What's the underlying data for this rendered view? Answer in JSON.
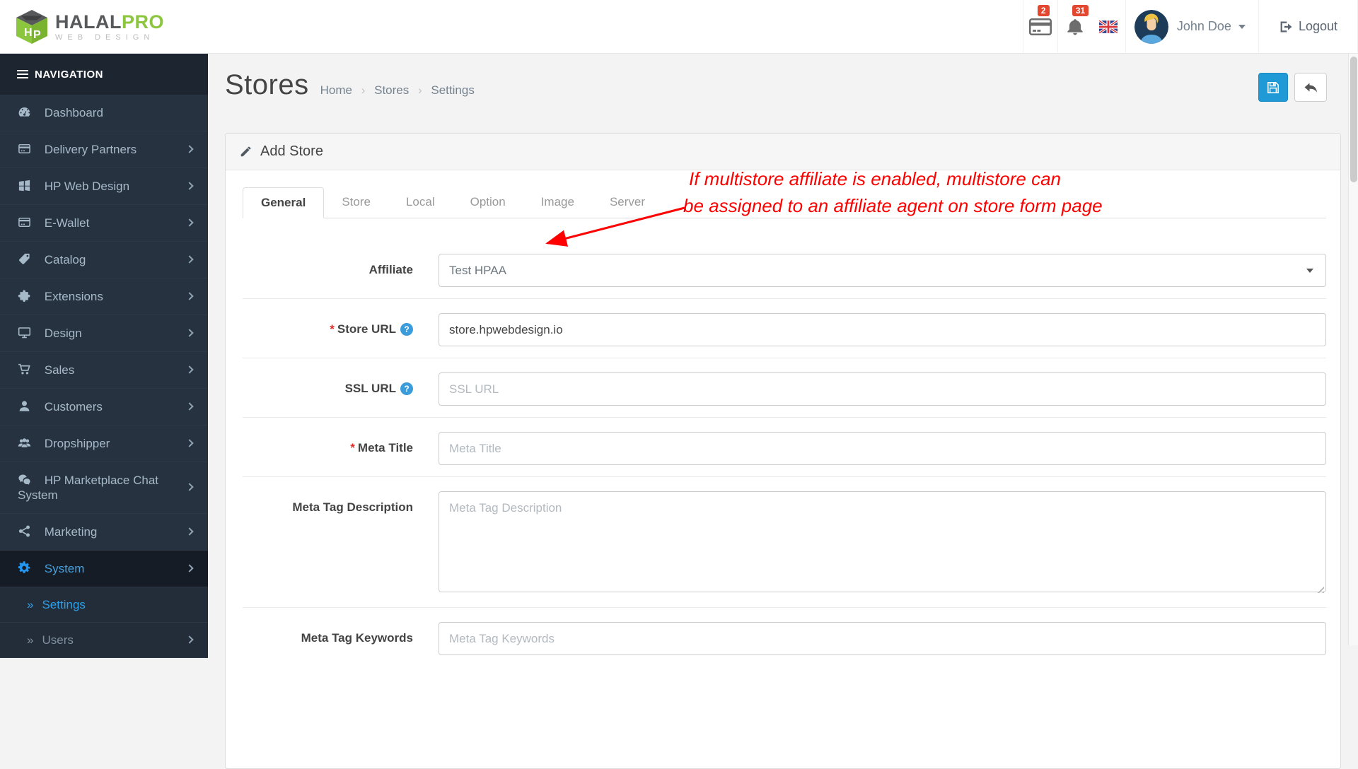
{
  "header": {
    "brand": {
      "name_primary": "HALAL",
      "name_accent": "PRO",
      "tagline": "WEB DESIGN",
      "monogram": "HP"
    },
    "payment_badge": "2",
    "notification_badge": "31",
    "user_name": "John Doe",
    "logout_label": "Logout",
    "icons": [
      "credit-card-icon",
      "bell-icon",
      "uk-flag-icon",
      "avatar",
      "caret-down-icon",
      "logout-icon"
    ]
  },
  "sidebar": {
    "nav_header": "NAVIGATION",
    "submenu_marker": "»",
    "items": [
      {
        "label": "Dashboard",
        "icon": "tachometer-icon",
        "chevron": false
      },
      {
        "label": "Delivery Partners",
        "icon": "card-list-icon",
        "chevron": true
      },
      {
        "label": "HP Web Design",
        "icon": "windows-icon",
        "chevron": true
      },
      {
        "label": "E-Wallet",
        "icon": "credit-card-icon",
        "chevron": true
      },
      {
        "label": "Catalog",
        "icon": "tags-icon",
        "chevron": true
      },
      {
        "label": "Extensions",
        "icon": "puzzle-icon",
        "chevron": true
      },
      {
        "label": "Design",
        "icon": "monitor-icon",
        "chevron": true
      },
      {
        "label": "Sales",
        "icon": "cart-icon",
        "chevron": true
      },
      {
        "label": "Customers",
        "icon": "user-icon",
        "chevron": true
      },
      {
        "label": "Dropshipper",
        "icon": "users-icon",
        "chevron": true
      },
      {
        "label": "HP Marketplace Chat System",
        "icon": "chat-bubbles-icon",
        "chevron": true
      },
      {
        "label": "Marketing",
        "icon": "share-icon",
        "chevron": true
      },
      {
        "label": "System",
        "icon": "gear-icon",
        "chevron": true,
        "active": true
      }
    ],
    "subitems": [
      {
        "label": "Settings",
        "active": true
      },
      {
        "label": "Users",
        "active": false,
        "chevron": true
      }
    ]
  },
  "page": {
    "title": "Stores",
    "breadcrumb_separator": "›",
    "breadcrumb": [
      "Home",
      "Stores",
      "Settings"
    ]
  },
  "actions": {
    "save_icon": "floppy-save-icon",
    "back_icon": "reply-arrow-icon"
  },
  "panel": {
    "heading": "Add Store",
    "heading_icon": "pencil-icon",
    "tabs": [
      "General",
      "Store",
      "Local",
      "Option",
      "Image",
      "Server"
    ],
    "active_tab": "General"
  },
  "annotation": {
    "line1": "If multistore affiliate is enabled, multistore can",
    "line2": "be assigned to an affiliate agent on store form page",
    "color": "#ff0000"
  },
  "form": {
    "required_marker": "*",
    "help_glyph": "?",
    "fields": [
      {
        "label": "Affiliate",
        "type": "select",
        "value": "Test HPAA",
        "required": false,
        "help": false
      },
      {
        "label": "Store URL",
        "type": "text",
        "value": "store.hpwebdesign.io",
        "required": true,
        "help": true
      },
      {
        "label": "SSL URL",
        "type": "text",
        "value": "",
        "placeholder": "SSL URL",
        "required": false,
        "help": true
      },
      {
        "label": "Meta Title",
        "type": "text",
        "value": "",
        "placeholder": "Meta Title",
        "required": true,
        "help": false
      },
      {
        "label": "Meta Tag Description",
        "type": "textarea",
        "value": "",
        "placeholder": "Meta Tag Description",
        "required": false,
        "help": false
      },
      {
        "label": "Meta Tag Keywords",
        "type": "text",
        "value": "",
        "placeholder": "Meta Tag Keywords",
        "required": false,
        "help": false
      }
    ]
  },
  "colors": {
    "accent_blue": "#2196f3",
    "link_blue": "#3596d3",
    "save_button_blue": "#1f9ad6",
    "brand_green": "#8cc63e",
    "badge_red": "#e3472f",
    "annotation_red": "#ff0000",
    "sidebar_bg": "#273240"
  }
}
